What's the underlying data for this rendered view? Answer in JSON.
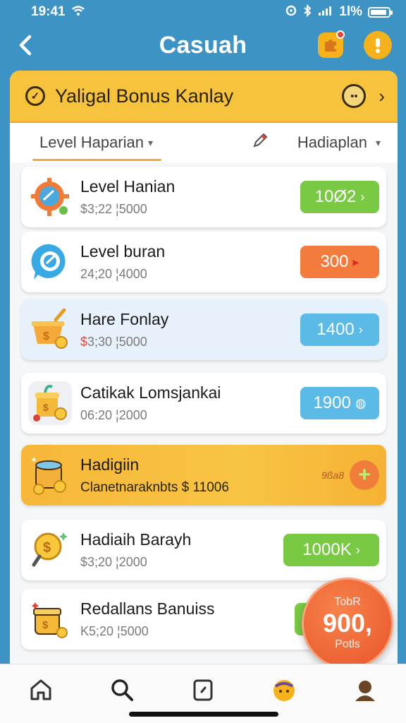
{
  "status_bar": {
    "time": "19:41",
    "right_text": "1l%"
  },
  "header": {
    "title": "Casuah"
  },
  "banner": {
    "title": "Yaligal Bonus Kanlay"
  },
  "filters": {
    "left_label": "Level Haparian",
    "right_label": "Hadiaplan"
  },
  "rewards": [
    {
      "title": "Level Hanian",
      "subtitle": "$3;22 ¦5000",
      "badge": "10Ø2",
      "badge_color": "#79c945",
      "icon": "gear-target-icon"
    },
    {
      "title": "Level buran",
      "subtitle": "24;20 ¦4000",
      "badge": "300",
      "badge_color": "#f47b3e",
      "icon": "target-chat-icon"
    },
    {
      "title": "Hare Fonlay",
      "subtitle_prefix": "$",
      "subtitle": "3;30 ¦5000",
      "badge": "1400",
      "badge_color": "#5cbbe6",
      "icon": "money-pot-icon"
    },
    {
      "title": "Catikak Lomsjankai",
      "subtitle": "06:20 ¦2000",
      "badge": "1900",
      "badge_color": "#5cbbe6",
      "icon": "money-jar-icon"
    },
    {
      "title": "Hadigiin",
      "subtitle": "Clanetnaraknbts $ 11006",
      "tag": "9ßa8",
      "icon": "honey-pot-icon"
    },
    {
      "title": "Hadiaih Barayh",
      "subtitle": "$3;20 ¦2000",
      "badge": "1000K",
      "badge_color": "#79c945",
      "icon": "coin-magnifier-icon"
    },
    {
      "title": "Redallans Banuiss",
      "subtitle": "K5;20 ¦5000",
      "badge": "",
      "badge_color": "#79c945",
      "icon": "coin-jar-icon"
    }
  ],
  "total_fab": {
    "top": "TobR",
    "value": "900,",
    "bottom": "Potls"
  },
  "tabs": [
    "home-icon",
    "search-icon",
    "clock-square-icon",
    "badge-face-icon",
    "profile-icon"
  ]
}
